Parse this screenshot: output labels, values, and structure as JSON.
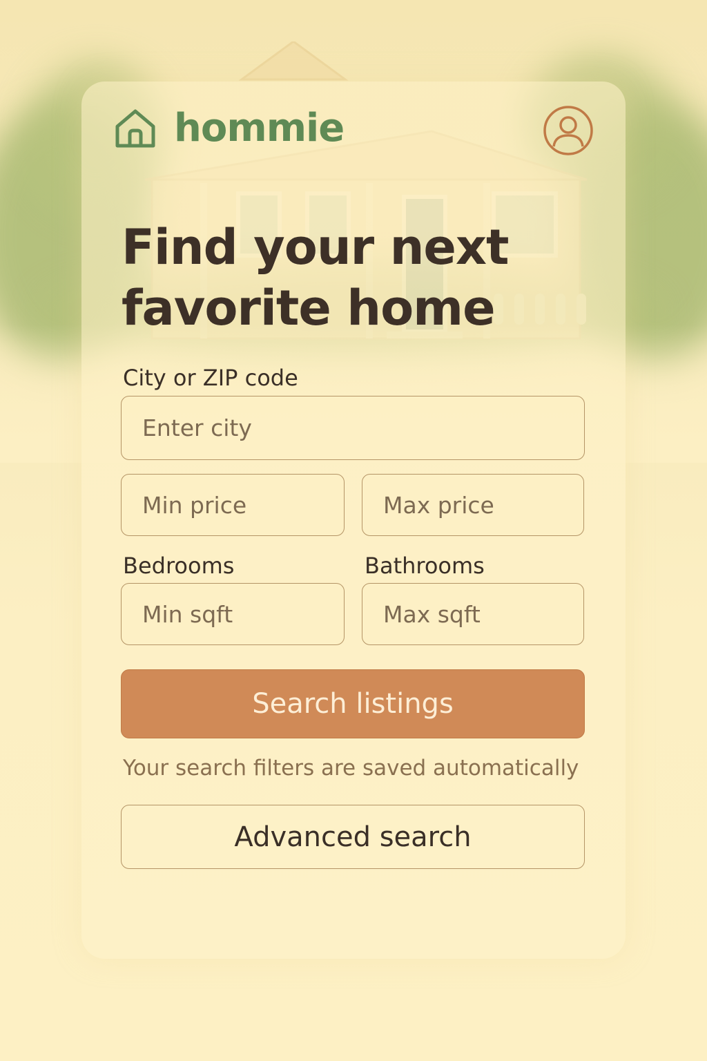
{
  "brand": {
    "name": "hommie",
    "logo_icon": "house-icon",
    "color": "#5f8a55"
  },
  "header": {
    "profile_icon": "user-avatar-icon"
  },
  "hero": {
    "headline": "Find your next favorite home"
  },
  "form": {
    "city_label": "City or ZIP code",
    "city_placeholder": "Enter city",
    "min_price_placeholder": "Min price",
    "max_price_placeholder": "Max price",
    "bedrooms_label": "Bedrooms",
    "bathrooms_label": "Bathrooms",
    "min_sqft_placeholder": "Min sqft",
    "max_sqft_placeholder": "Max sqft",
    "search_button": "Search listings",
    "helper_text": "Your search filters are saved automatically",
    "advanced_button": "Advanced search"
  },
  "colors": {
    "accent": "#d08a57",
    "background": "#fcefc0",
    "text": "#3d3027"
  }
}
